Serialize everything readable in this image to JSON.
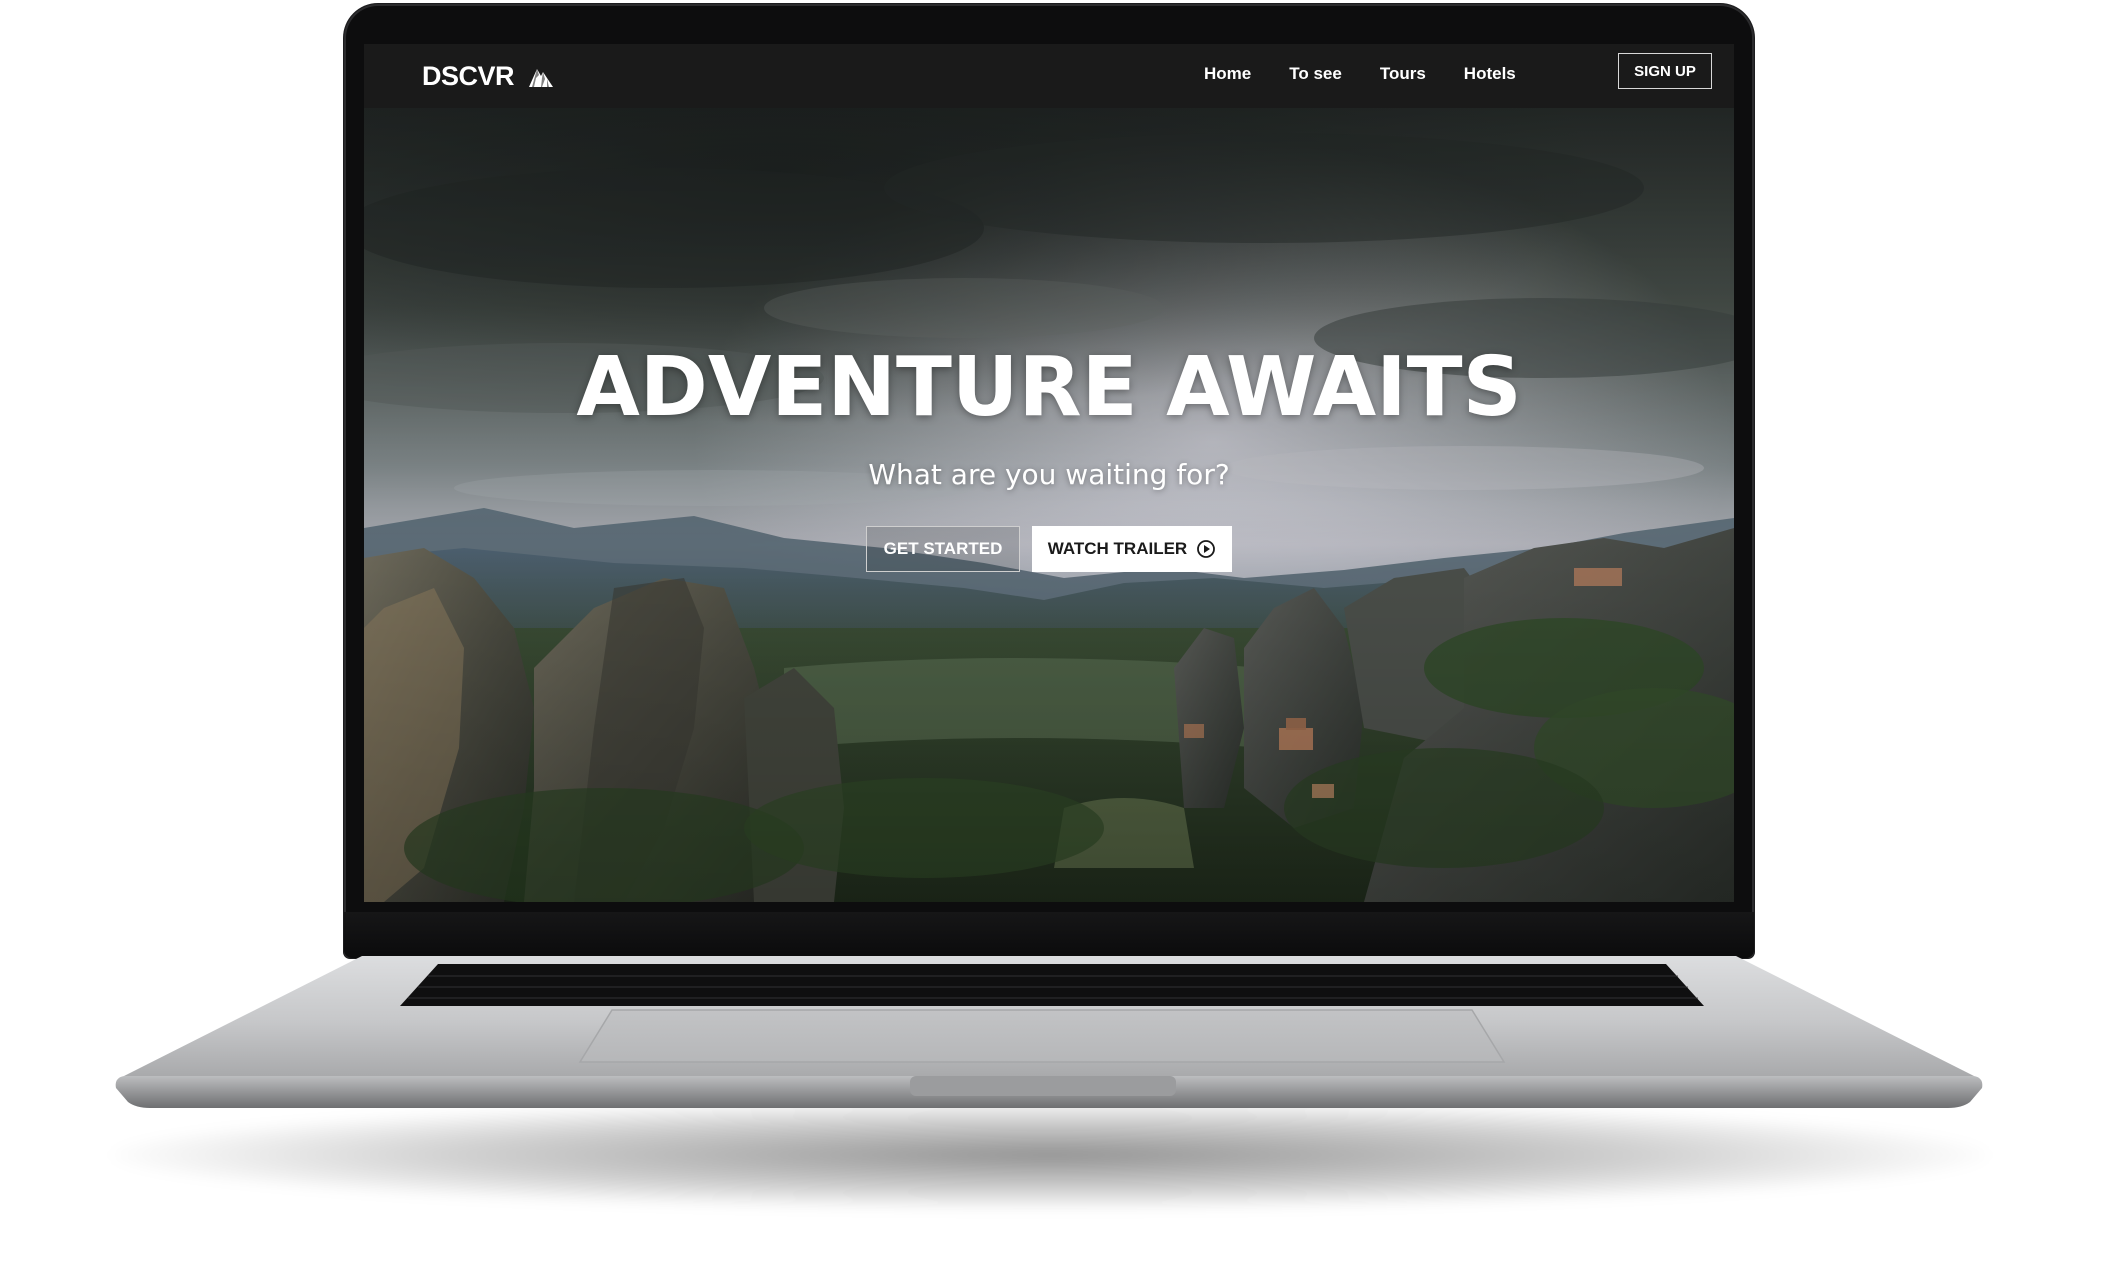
{
  "navbar": {
    "brand": "DSCVR",
    "brand_icon": "mountain-icon",
    "links": [
      "Home",
      "To see",
      "Tours",
      "Hotels"
    ],
    "signup_label": "SIGN UP"
  },
  "hero": {
    "title": "ADVENTURE AWAITS",
    "subtitle": "What are you waiting for?",
    "primary_cta": "GET STARTED",
    "secondary_cta": "WATCH TRAILER",
    "secondary_cta_icon": "play-circle-icon"
  },
  "colors": {
    "navbar_bg": "#1a1a1a",
    "accent_white": "#ffffff",
    "laptop_frame": "#0d0d0e",
    "laptop_body": "#c9cacc"
  }
}
